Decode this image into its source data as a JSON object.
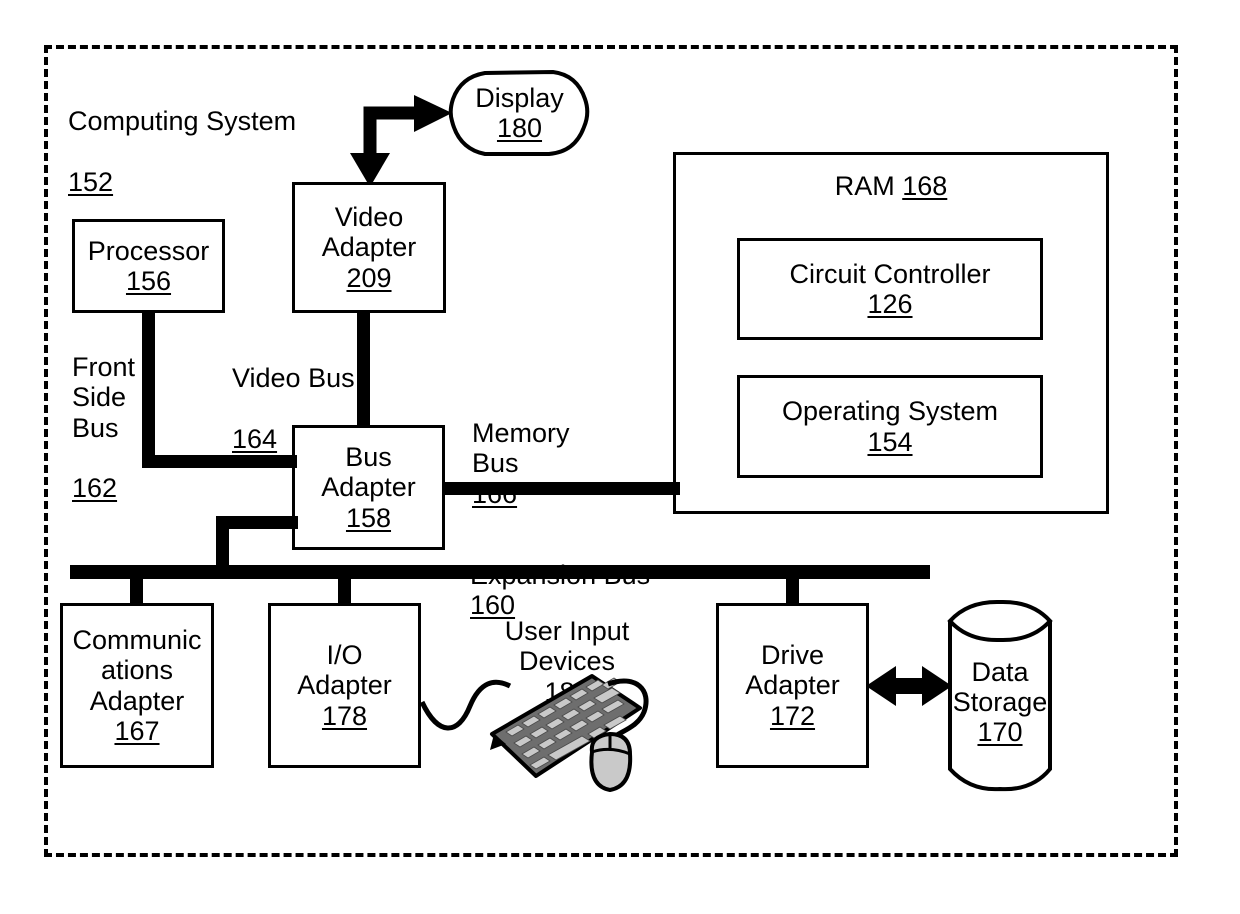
{
  "figure": {
    "type": "patent-block-diagram",
    "title": "Computing System block diagram"
  },
  "system": {
    "label": "Computing System",
    "ref": "152"
  },
  "nodes": {
    "display": {
      "label": "Display",
      "ref": "180",
      "shape": "oval"
    },
    "video_adapter": {
      "label": "Video\nAdapter",
      "ref": "209",
      "shape": "rect"
    },
    "processor": {
      "label": "Processor",
      "ref": "156",
      "shape": "rect"
    },
    "bus_adapter": {
      "label": "Bus\nAdapter",
      "ref": "158",
      "shape": "rect"
    },
    "ram": {
      "label": "RAM",
      "ref": "168",
      "shape": "rect"
    },
    "circuit_controller": {
      "label": "Circuit Controller",
      "ref": "126",
      "shape": "rect"
    },
    "operating_system": {
      "label": "Operating System",
      "ref": "154",
      "shape": "rect"
    },
    "communications_adapter": {
      "label": "Communic\nations\nAdapter",
      "ref": "167",
      "shape": "rect"
    },
    "io_adapter": {
      "label": "I/O\nAdapter",
      "ref": "178",
      "shape": "rect"
    },
    "drive_adapter": {
      "label": "Drive\nAdapter",
      "ref": "172",
      "shape": "rect"
    },
    "data_storage": {
      "label": "Data\nStorage",
      "ref": "170",
      "shape": "cylinder"
    },
    "user_input_devices": {
      "label": "User Input\nDevices",
      "ref": "181",
      "shape": "illustration"
    }
  },
  "buses": {
    "front_side_bus": {
      "label": "Front\nSide\nBus",
      "ref": "162"
    },
    "video_bus": {
      "label": "Video Bus",
      "ref": "164"
    },
    "memory_bus": {
      "label": "Memory\nBus",
      "ref": "166"
    },
    "expansion_bus": {
      "label": "Expansion Bus",
      "ref": "160"
    }
  },
  "colors": {
    "stroke": "#000000",
    "fill": "#ffffff",
    "key_fill": "#b8b8b8",
    "body_fill": "#6e6e6e"
  }
}
